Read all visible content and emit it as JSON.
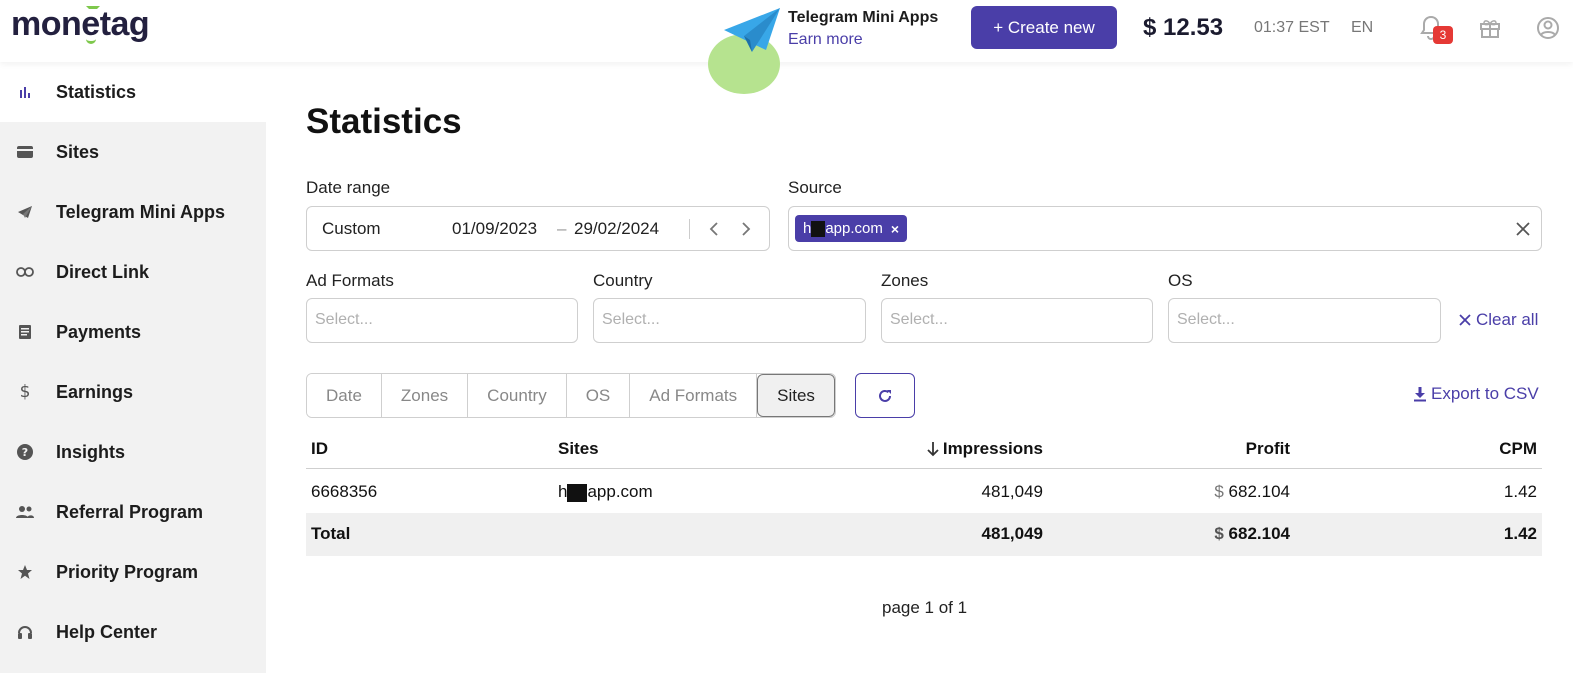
{
  "brand": {
    "logo_prefix": "mon",
    "logo_e": "e",
    "logo_suffix": "tag"
  },
  "promo": {
    "title": "Telegram Mini Apps",
    "link": "Earn more"
  },
  "header": {
    "create_label": "+ Create new",
    "balance": "$ 12.53",
    "time": "01:37 EST",
    "language": "EN",
    "notification_count": "3",
    "accent_color": "#4a3ea8",
    "badge_color": "#e53935"
  },
  "sidebar": {
    "items": [
      {
        "label": "Statistics",
        "icon": "bar-chart-icon",
        "active": true
      },
      {
        "label": "Sites",
        "icon": "card-icon"
      },
      {
        "label": "Telegram Mini Apps",
        "icon": "telegram-icon"
      },
      {
        "label": "Direct Link",
        "icon": "link-icon"
      },
      {
        "label": "Payments",
        "icon": "document-icon"
      },
      {
        "label": "Earnings",
        "icon": "dollar-icon"
      },
      {
        "label": "Insights",
        "icon": "help-circle-icon"
      },
      {
        "label": "Referral Program",
        "icon": "people-icon"
      },
      {
        "label": "Priority Program",
        "icon": "star-icon"
      },
      {
        "label": "Help Center",
        "icon": "headset-icon"
      }
    ]
  },
  "main": {
    "title": "Statistics",
    "filters": {
      "date_range_label": "Date range",
      "date_preset": "Custom",
      "date_from": "01/09/2023",
      "date_dash": "–",
      "date_to": "29/02/2024",
      "source_label": "Source",
      "source_chip_pre": "h",
      "source_chip_post": "app.com",
      "source_chip_remove": "×",
      "ad_formats_label": "Ad Formats",
      "country_label": "Country",
      "zones_label": "Zones",
      "os_label": "OS",
      "placeholder": "Select...",
      "clear_all": "Clear all"
    },
    "group_tabs": [
      "Date",
      "Zones",
      "Country",
      "OS",
      "Ad Formats",
      "Sites"
    ],
    "active_group": "Sites",
    "export_label": "Export to CSV",
    "table": {
      "columns": [
        "ID",
        "Sites",
        "Impressions",
        "Profit",
        "CPM"
      ],
      "rows": [
        {
          "id": "6668356",
          "site_pre": "h",
          "site_post": "app.com",
          "impressions": "481,049",
          "currency": "$",
          "profit": "682.104",
          "cpm": "1.42"
        }
      ],
      "total": {
        "label": "Total",
        "impressions": "481,049",
        "currency": "$",
        "profit": "682.104",
        "cpm": "1.42"
      }
    },
    "pagination": "page 1 of 1"
  }
}
